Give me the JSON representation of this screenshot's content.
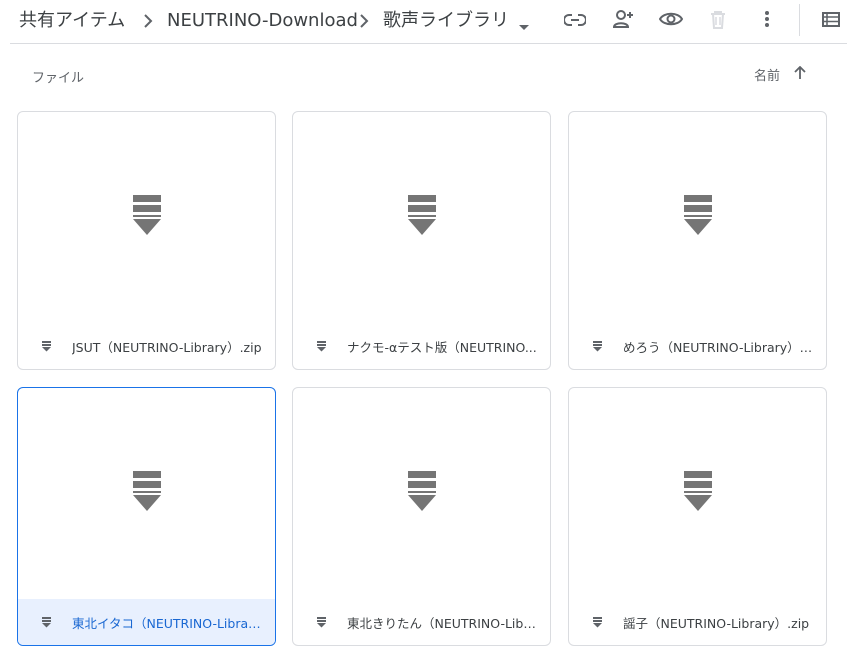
{
  "breadcrumb": {
    "items": [
      "共有アイテム",
      "NEUTRINO-Download",
      "歌声ライブラリ"
    ]
  },
  "toolbar": {
    "icons": [
      "link-icon",
      "add-person-icon",
      "eye-icon",
      "trash-icon",
      "more-vert-icon",
      "list-view-icon"
    ]
  },
  "section": {
    "label": "ファイル"
  },
  "sort": {
    "label": "名前",
    "direction": "ascending"
  },
  "files": [
    {
      "name": "JSUT（NEUTRINO-Library）.zip",
      "selected": false
    },
    {
      "name": "ナクモ-αテスト版（NEUTRINO...",
      "selected": false
    },
    {
      "name": "めろう（NEUTRINO-Library）....",
      "selected": false
    },
    {
      "name": "東北イタコ（NEUTRINO-Librar...",
      "selected": true
    },
    {
      "name": "東北きりたん（NEUTRINO-Libr...",
      "selected": false
    },
    {
      "name": "謡子（NEUTRINO-Library）.zip",
      "selected": false
    }
  ],
  "colors": {
    "icon_gray": "#757575",
    "accent_blue": "#1a73e8",
    "selected_bg": "#e8f0fe"
  }
}
